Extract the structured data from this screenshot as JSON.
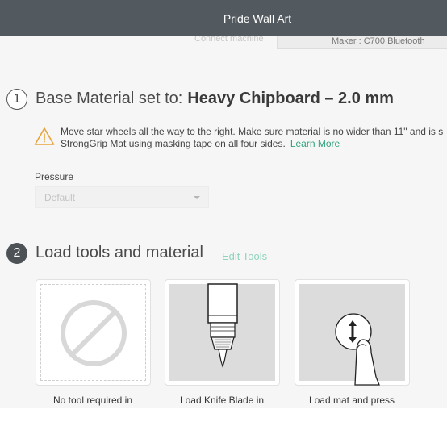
{
  "window": {
    "title": "Pride Wall Art"
  },
  "machine": {
    "connect_label": "Connect machine",
    "selected_machine": "Maker : C700 Bluetooth"
  },
  "step1": {
    "number": "1",
    "heading_prefix": "Base Material set to:",
    "material": "Heavy Chipboard – 2.0 mm",
    "warning_line1": "Move star wheels all the way to the right. Make sure material is no wider than 11\" and is s",
    "warning_line2": "StrongGrip Mat using masking tape on all four sides.",
    "learn_more": "Learn More",
    "pressure_label": "Pressure",
    "pressure_value": "Default"
  },
  "step2": {
    "number": "2",
    "heading": "Load tools and material",
    "edit_tools": "Edit Tools",
    "cards": [
      {
        "caption": "No tool required in",
        "icon": "no-tool-icon"
      },
      {
        "caption": "Load Knife Blade in",
        "icon": "knife-blade-icon"
      },
      {
        "caption": "Load mat and press",
        "icon": "load-mat-button-icon"
      }
    ]
  },
  "colors": {
    "titlebar": "#525a60",
    "accent_green": "#2ea37b",
    "edit_tools_green": "#8fd4bb",
    "warning_orange": "#e8a33a"
  }
}
